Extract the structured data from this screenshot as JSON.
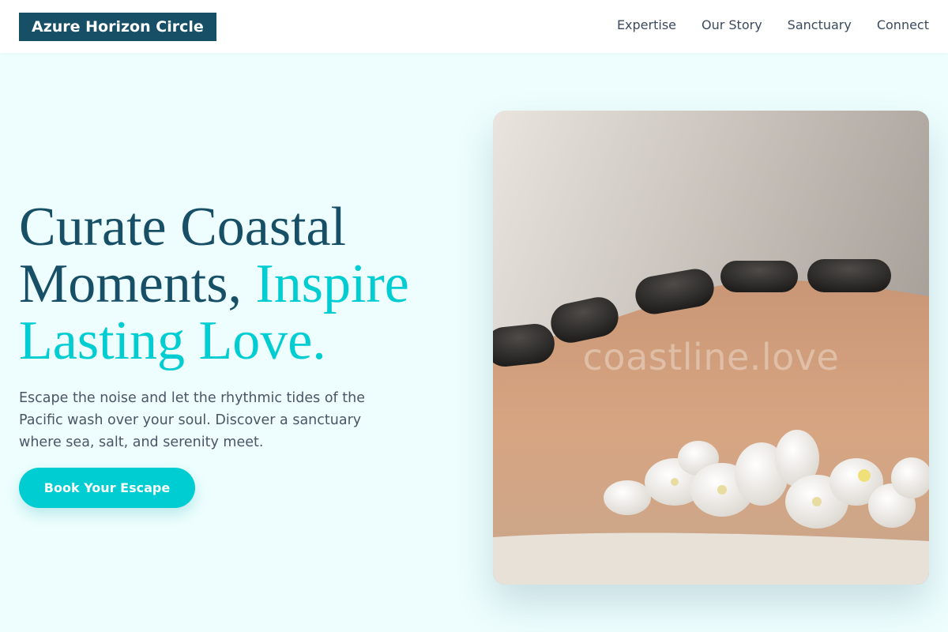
{
  "brand": {
    "name": "Azure Horizon Circle"
  },
  "nav": {
    "items": [
      {
        "label": "Expertise"
      },
      {
        "label": "Our Story"
      },
      {
        "label": "Sanctuary"
      },
      {
        "label": "Connect"
      }
    ]
  },
  "hero": {
    "title_line1": "Curate Coastal",
    "title_line2": "Moments,",
    "title_accent_1": "Inspire",
    "title_accent_2": "Lasting Love.",
    "description": "Escape the noise and let the rhythmic tides of the Pacific wash over your soul. Discover a sanctuary where sea, salt, and serenity meet.",
    "cta_label": "Book Your Escape",
    "image_watermark": "coastline.love"
  },
  "colors": {
    "background": "#eefefe",
    "brand_dark": "#174f66",
    "accent": "#00cdd2",
    "text_muted": "#4a5566"
  },
  "icons": {
    "hero_image": "hot-stone-massage-photo"
  }
}
